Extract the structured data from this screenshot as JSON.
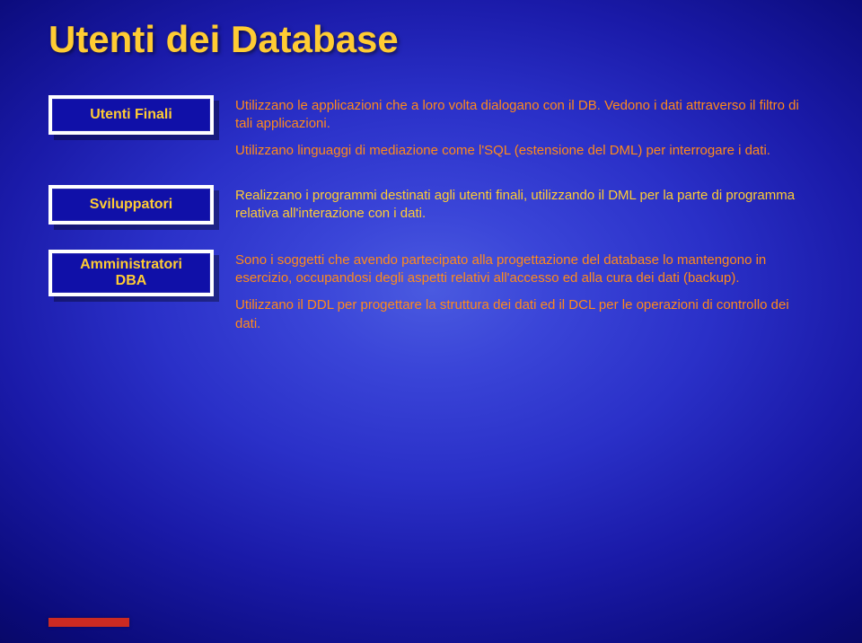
{
  "title": "Utenti dei Database",
  "rows": [
    {
      "label": "Utenti Finali",
      "color_class": "orange",
      "paras": [
        "Utilizzano le applicazioni che a loro volta dialogano con il DB. Vedono i dati attraverso il filtro di tali applicazioni.",
        "Utilizzano linguaggi di mediazione come l'SQL (estensione del DML) per interrogare i dati."
      ],
      "data_name": "row-utenti-finali"
    },
    {
      "label": "Sviluppatori",
      "color_class": "yellow",
      "paras": [
        "Realizzano i programmi destinati agli utenti finali, utilizzando il DML per la parte di programma relativa all'interazione con i dati."
      ],
      "data_name": "row-sviluppatori"
    },
    {
      "label": "Amministratori\nDBA",
      "color_class": "orange",
      "paras": [
        "Sono i soggetti che avendo partecipato alla progettazione del database lo mantengono in esercizio, occupandosi degli aspetti relativi all'accesso ed alla cura dei dati (backup).",
        "Utilizzano il DDL per progettare la struttura dei dati ed il DCL per le operazioni di controllo dei dati."
      ],
      "data_name": "row-amministratori"
    }
  ]
}
